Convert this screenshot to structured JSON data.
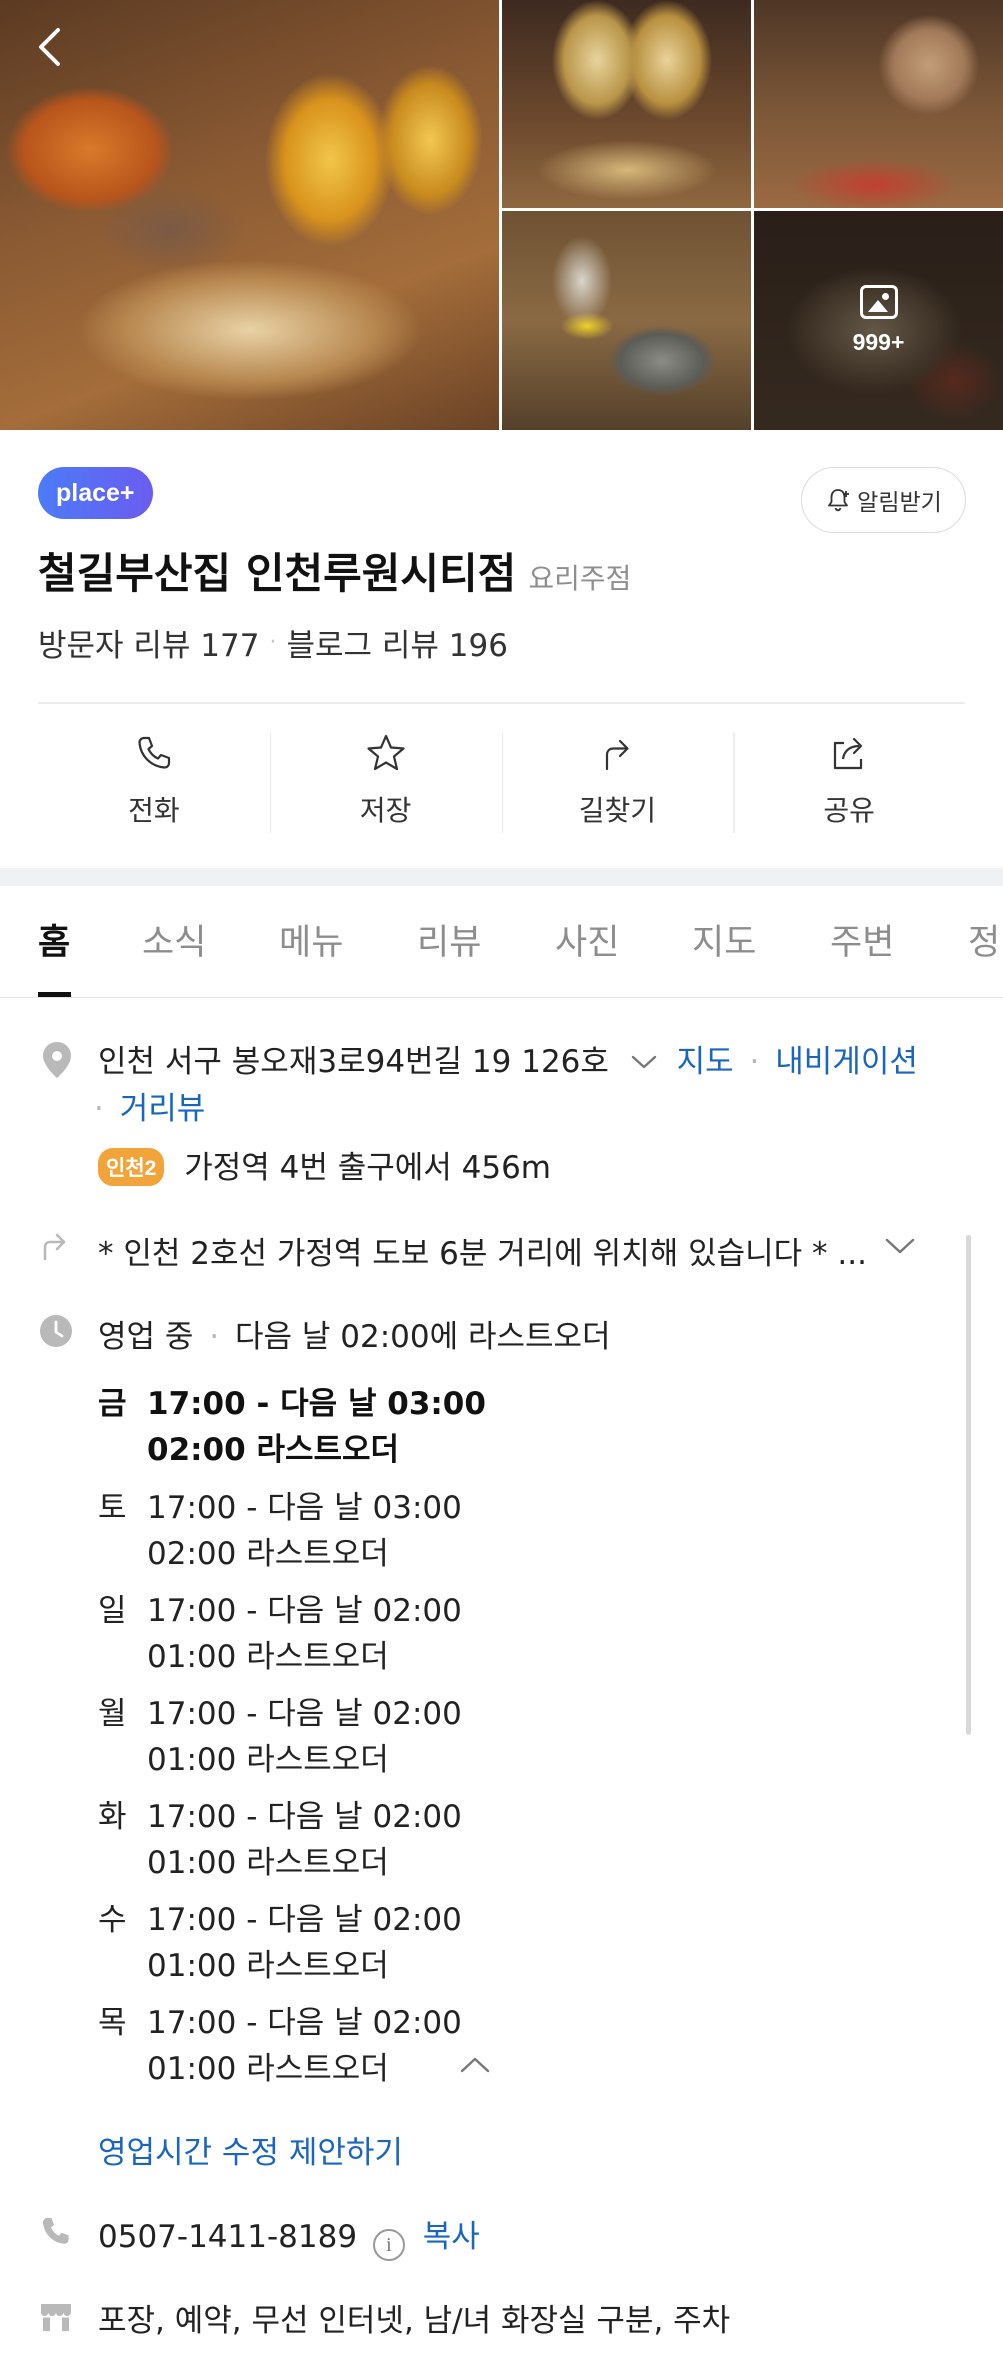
{
  "gallery": {
    "more_count": "999+"
  },
  "header": {
    "badge": "place+",
    "alarm_label": "알림받기",
    "name": "철길부산집 인천루원시티점",
    "category": "요리주점",
    "visitor_reviews": "방문자 리뷰 177",
    "dot": "·",
    "blog_reviews": "블로그 리뷰 196"
  },
  "actions": [
    {
      "label": "전화",
      "icon": "phone-icon"
    },
    {
      "label": "저장",
      "icon": "star-icon"
    },
    {
      "label": "길찾기",
      "icon": "directions-icon"
    },
    {
      "label": "공유",
      "icon": "share-icon"
    }
  ],
  "tabs": [
    "홈",
    "소식",
    "메뉴",
    "리뷰",
    "사진",
    "지도",
    "주변",
    "정"
  ],
  "address": {
    "text": "인천 서구 봉오재3로94번길 19 126호",
    "map_link": "지도",
    "navigation_link": "내비게이션",
    "roadview_link": "거리뷰",
    "dot": "·",
    "subway_line": "인천2",
    "subway_text": "가정역 4번 출구에서 456m"
  },
  "directions_note": "* 인천 2호선 가정역 도보 6분 거리에 위치해 있습니다 * ...",
  "hours": {
    "status": "영업 중",
    "dot": "·",
    "summary": "다음 날 02:00에 라스트오더",
    "days": [
      {
        "day": "금",
        "time": "17:00 - 다음 날 03:00",
        "last_order": "02:00 라스트오더"
      },
      {
        "day": "토",
        "time": "17:00 - 다음 날 03:00",
        "last_order": "02:00 라스트오더"
      },
      {
        "day": "일",
        "time": "17:00 - 다음 날 02:00",
        "last_order": "01:00 라스트오더"
      },
      {
        "day": "월",
        "time": "17:00 - 다음 날 02:00",
        "last_order": "01:00 라스트오더"
      },
      {
        "day": "화",
        "time": "17:00 - 다음 날 02:00",
        "last_order": "01:00 라스트오더"
      },
      {
        "day": "수",
        "time": "17:00 - 다음 날 02:00",
        "last_order": "01:00 라스트오더"
      },
      {
        "day": "목",
        "time": "17:00 - 다음 날 02:00",
        "last_order": "01:00 라스트오더"
      }
    ],
    "suggest_edit": "영업시간 수정 제안하기"
  },
  "phone": {
    "number": "0507-1411-8189",
    "info_glyph": "i",
    "copy_label": "복사"
  },
  "amenities": "포장, 예약, 무선 인터넷, 남/녀 화장실 구분, 주차",
  "colors": {
    "accent_link": "#1a65c0",
    "subway_line2": "#f0a43a",
    "badge_gradient_start": "#4c7bf6",
    "badge_gradient_end": "#6b5cf0"
  }
}
